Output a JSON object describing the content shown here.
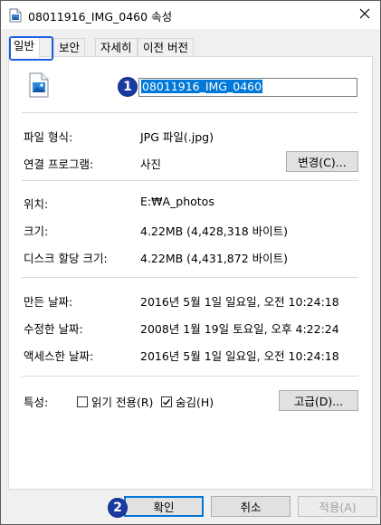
{
  "window": {
    "title": "08011916_IMG_0460 속성",
    "icon": "image-file-icon"
  },
  "tabs": [
    {
      "label": "일반",
      "active": true
    },
    {
      "label": "보안"
    },
    {
      "label": "자세히"
    },
    {
      "label": "이전 버전"
    }
  ],
  "general": {
    "file_name": "08011916_IMG_0460",
    "file_type_label": "파일 형식:",
    "file_type_value": "JPG 파일(.jpg)",
    "open_with_label": "연결 프로그램:",
    "open_with_value": "사진",
    "change_button": "변경(C)...",
    "location_label": "위치:",
    "location_value": "E:₩A_photos",
    "size_label": "크기:",
    "size_value": "4.22MB (4,428,318 바이트)",
    "size_on_disk_label": "디스크 할당 크기:",
    "size_on_disk_value": "4.22MB (4,431,872 바이트)",
    "created_label": "만든 날짜:",
    "created_value": "2016년 5월 1일 일요일, 오전 10:24:18",
    "modified_label": "수정한 날짜:",
    "modified_value": "2008년 1월 19일 토요일, 오후 4:22:24",
    "accessed_label": "액세스한 날짜:",
    "accessed_value": "2016년 5월 1일 일요일, 오전 10:24:18",
    "attributes_label": "특성:",
    "readonly_label": "읽기 전용(R)",
    "readonly_checked": false,
    "hidden_label": "숨김(H)",
    "hidden_checked": true,
    "advanced_button": "고급(D)..."
  },
  "footer": {
    "ok": "확인",
    "cancel": "취소",
    "apply": "적용(A)"
  },
  "badges": {
    "one": "1",
    "two": "2"
  },
  "colors": {
    "selection": "#0078d7",
    "badge": "#1a3aa0",
    "focus": "#1e5fe0"
  }
}
